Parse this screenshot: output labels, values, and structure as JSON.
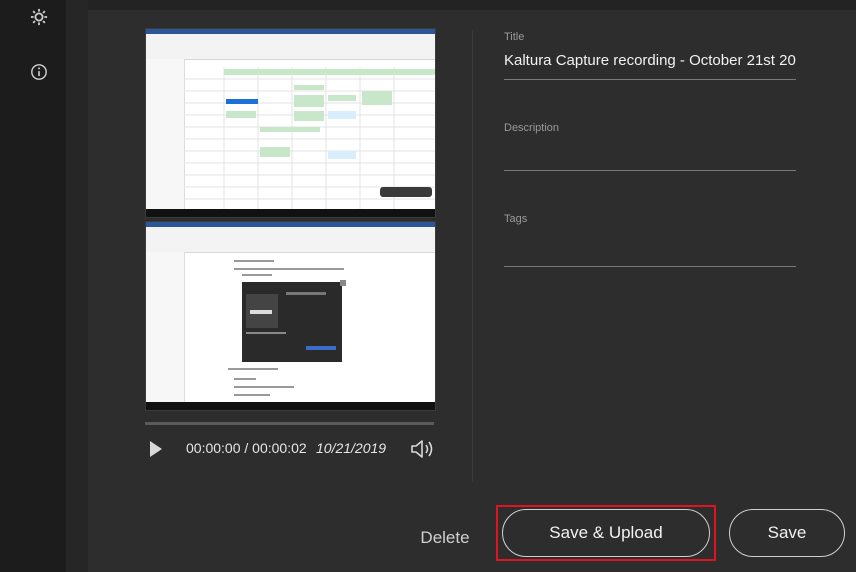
{
  "sidebar": {
    "icons": [
      {
        "name": "settings-icon"
      },
      {
        "name": "info-icon"
      }
    ]
  },
  "player": {
    "timecode": "00:00:00 / 00:00:02",
    "date": "10/21/2019"
  },
  "form": {
    "title_label": "Title",
    "title_value": "Kaltura Capture recording - October 21st 20",
    "description_label": "Description",
    "tags_label": "Tags"
  },
  "actions": {
    "delete_label": "Delete",
    "save_upload_label": "Save & Upload",
    "save_label": "Save"
  },
  "colors": {
    "background": "#2d2d2d",
    "sidebar": "#1c1c1c",
    "highlight": "#e0141e"
  }
}
